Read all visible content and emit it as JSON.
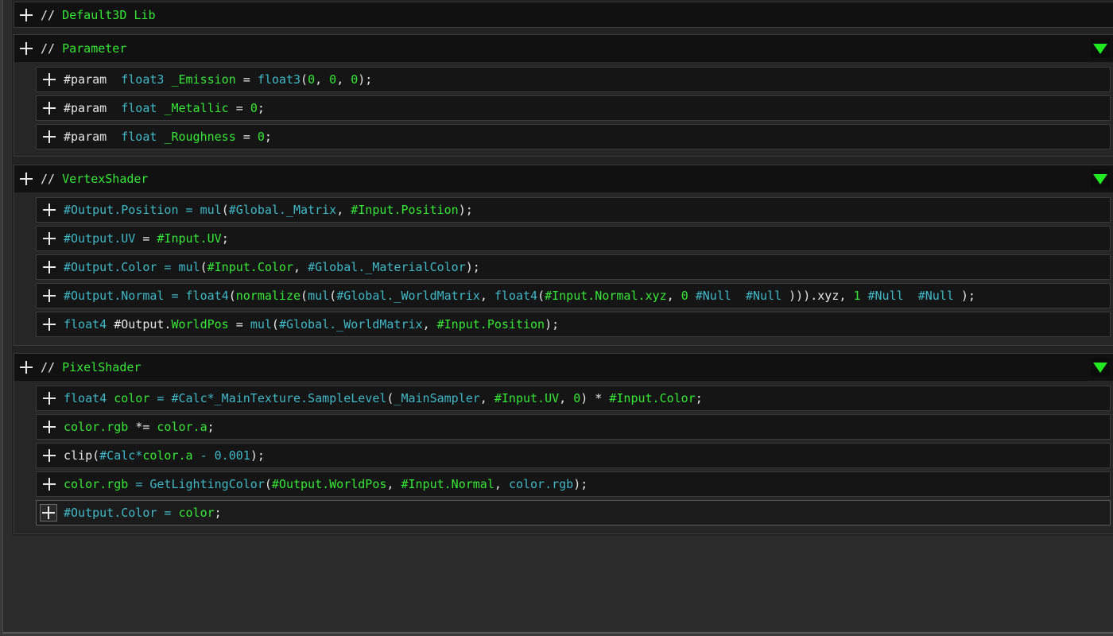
{
  "lib_header": {
    "segments": [
      [
        "w",
        "// "
      ],
      [
        "g",
        "Default3D Lib"
      ]
    ]
  },
  "blocks": [
    {
      "title": [
        [
          "w",
          "// "
        ],
        [
          "g",
          "Parameter"
        ]
      ],
      "rows": [
        [
          [
            "w",
            "#param  "
          ],
          [
            "c",
            "float3 "
          ],
          [
            "g",
            "_Emission "
          ],
          [
            "w",
            "= "
          ],
          [
            "c",
            "float3"
          ],
          [
            "w",
            "("
          ],
          [
            "g",
            "0"
          ],
          [
            "w",
            ", "
          ],
          [
            "g",
            "0"
          ],
          [
            "w",
            ", "
          ],
          [
            "g",
            "0"
          ],
          [
            "w",
            ");"
          ]
        ],
        [
          [
            "w",
            "#param  "
          ],
          [
            "c",
            "float "
          ],
          [
            "g",
            "_Metallic "
          ],
          [
            "w",
            "= "
          ],
          [
            "g",
            "0"
          ],
          [
            "w",
            ";"
          ]
        ],
        [
          [
            "w",
            "#param  "
          ],
          [
            "c",
            "float "
          ],
          [
            "g",
            "_Roughness "
          ],
          [
            "w",
            "= "
          ],
          [
            "g",
            "0"
          ],
          [
            "w",
            ";"
          ]
        ]
      ]
    },
    {
      "title": [
        [
          "w",
          "// "
        ],
        [
          "g",
          "VertexShader"
        ]
      ],
      "rows": [
        [
          [
            "c",
            "#Output.Position = mul"
          ],
          [
            "w",
            "("
          ],
          [
            "c",
            "#Global._Matrix"
          ],
          [
            "w",
            ", "
          ],
          [
            "g",
            "#Input.Position"
          ],
          [
            "w",
            ");"
          ]
        ],
        [
          [
            "c",
            "#Output.UV "
          ],
          [
            "w",
            "= "
          ],
          [
            "g",
            "#Input.UV"
          ],
          [
            "w",
            ";"
          ]
        ],
        [
          [
            "c",
            "#Output.Color = mul"
          ],
          [
            "w",
            "("
          ],
          [
            "g",
            "#Input.Color"
          ],
          [
            "w",
            ", "
          ],
          [
            "c",
            "#Global._MaterialColor"
          ],
          [
            "w",
            ");"
          ]
        ],
        [
          [
            "c",
            "#Output.Normal = float4"
          ],
          [
            "w",
            "("
          ],
          [
            "g",
            "normalize"
          ],
          [
            "w",
            "("
          ],
          [
            "c",
            "mul"
          ],
          [
            "w",
            "("
          ],
          [
            "c",
            "#Global._WorldMatrix"
          ],
          [
            "w",
            ", "
          ],
          [
            "c",
            "float4"
          ],
          [
            "w",
            "("
          ],
          [
            "g",
            "#Input.Normal.xyz"
          ],
          [
            "w",
            ", "
          ],
          [
            "g",
            "0 "
          ],
          [
            "c",
            "#Null  #Null "
          ],
          [
            "w",
            ")))"
          ],
          [
            "w",
            ".xyz, "
          ],
          [
            "g",
            "1 "
          ],
          [
            "c",
            "#Null  #Null "
          ],
          [
            "w",
            ");"
          ]
        ],
        [
          [
            "c",
            "float4 "
          ],
          [
            "w",
            "#Output."
          ],
          [
            "g",
            "WorldPos "
          ],
          [
            "w",
            "= "
          ],
          [
            "c",
            "mul"
          ],
          [
            "w",
            "("
          ],
          [
            "c",
            "#Global._WorldMatrix"
          ],
          [
            "w",
            ", "
          ],
          [
            "g",
            "#Input.Position"
          ],
          [
            "w",
            ");"
          ]
        ]
      ]
    },
    {
      "title": [
        [
          "w",
          "// "
        ],
        [
          "g",
          "PixelShader"
        ]
      ],
      "rows": [
        [
          [
            "c",
            "float4 "
          ],
          [
            "g",
            "color "
          ],
          [
            "c",
            "= #Calc*_MainTexture.SampleLevel"
          ],
          [
            "w",
            "("
          ],
          [
            "c",
            "_MainSampler"
          ],
          [
            "w",
            ", "
          ],
          [
            "g",
            "#Input.UV"
          ],
          [
            "w",
            ", "
          ],
          [
            "g",
            "0"
          ],
          [
            "w",
            ") * "
          ],
          [
            "g",
            "#Input.Color"
          ],
          [
            "w",
            ";"
          ]
        ],
        [
          [
            "g",
            "color.rgb "
          ],
          [
            "w",
            "*= "
          ],
          [
            "g",
            "color.a"
          ],
          [
            "w",
            ";"
          ]
        ],
        [
          [
            "w",
            "clip("
          ],
          [
            "c",
            "#Calc*"
          ],
          [
            "g",
            "color.a "
          ],
          [
            "c",
            "- 0.001"
          ],
          [
            "w",
            ");"
          ]
        ],
        [
          [
            "g",
            "color.rgb "
          ],
          [
            "c",
            "= GetLightingColor"
          ],
          [
            "w",
            "("
          ],
          [
            "g",
            "#Output.WorldPos"
          ],
          [
            "w",
            ", "
          ],
          [
            "g",
            "#Input.Normal"
          ],
          [
            "w",
            ", "
          ],
          [
            "c",
            "color.rgb"
          ],
          [
            "w",
            ");"
          ]
        ],
        [
          [
            "c",
            "#Output.Color = "
          ],
          [
            "g",
            "color"
          ],
          [
            "w",
            ";"
          ]
        ]
      ]
    }
  ],
  "colors": {
    "white": "#e6e6e6",
    "green": "#35e835",
    "cyan": "#3fb8c8",
    "triangle": "#22e822"
  },
  "icons": {
    "expand": "plus-icon",
    "collapse": "triangle-down-icon"
  }
}
